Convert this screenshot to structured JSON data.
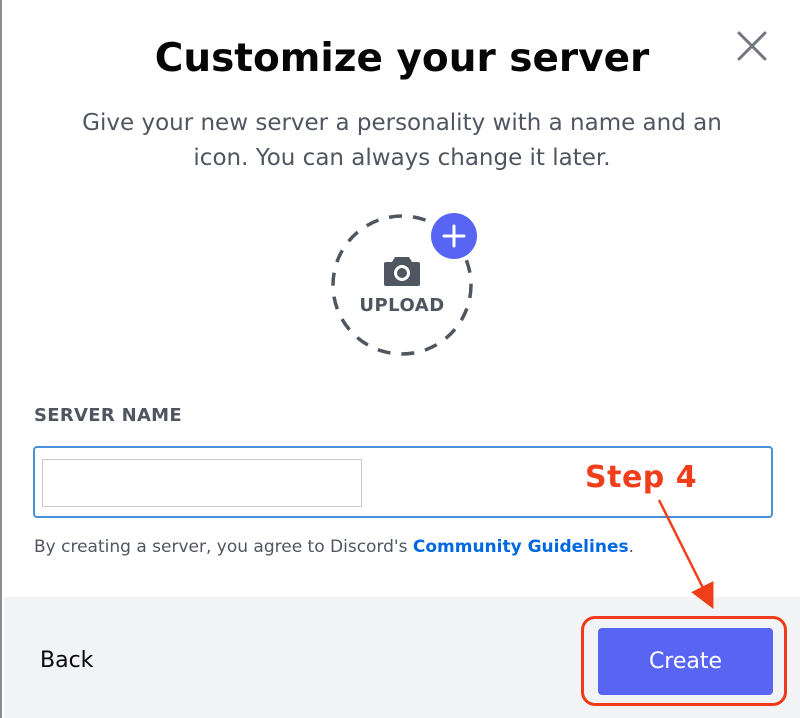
{
  "dialog": {
    "title": "Customize your server",
    "subtitle": "Give your new server a personality with a name and an icon. You can always change it later.",
    "close_icon": "close-icon",
    "upload": {
      "label": "UPLOAD",
      "camera_icon": "camera-icon",
      "plus_icon": "plus-icon"
    },
    "server_name": {
      "label": "SERVER NAME",
      "value": "",
      "placeholder": ""
    },
    "disclaimer": {
      "prefix": "By creating a server, you agree to Discord's ",
      "link": "Community Guidelines",
      "suffix": "."
    },
    "footer": {
      "back_label": "Back",
      "create_label": "Create"
    }
  },
  "annotation": {
    "step_label": "Step 4",
    "color": "#f03e1b"
  },
  "colors": {
    "brand": "#5865f2",
    "link": "#0068e0",
    "input_border": "#4a8fd9",
    "footer_bg": "#f2f3f5"
  }
}
